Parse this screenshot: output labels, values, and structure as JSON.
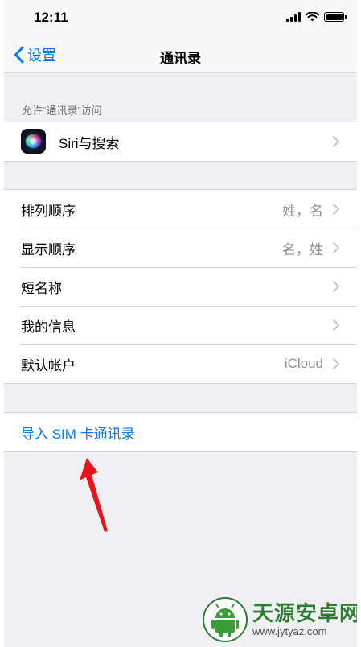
{
  "status_bar": {
    "time": "12:11"
  },
  "nav": {
    "back_label": "设置",
    "title": "通讯录"
  },
  "siri_section": {
    "header": "允许“通讯录”访问",
    "siri_label": "Siri与搜索"
  },
  "settings_rows": [
    {
      "label": "排列顺序",
      "value": "姓，名"
    },
    {
      "label": "显示顺序",
      "value": "名，姓"
    },
    {
      "label": "短名称",
      "value": ""
    },
    {
      "label": "我的信息",
      "value": ""
    },
    {
      "label": "默认帐户",
      "value": "iCloud"
    }
  ],
  "import_row": {
    "label": "导入 SIM 卡通讯录"
  },
  "colors": {
    "accent": "#007aff",
    "annotation": "#e8141c",
    "watermark": "#2e7d32"
  },
  "watermark": {
    "title": "天源安卓网",
    "url": "www.jytyaz.com"
  }
}
